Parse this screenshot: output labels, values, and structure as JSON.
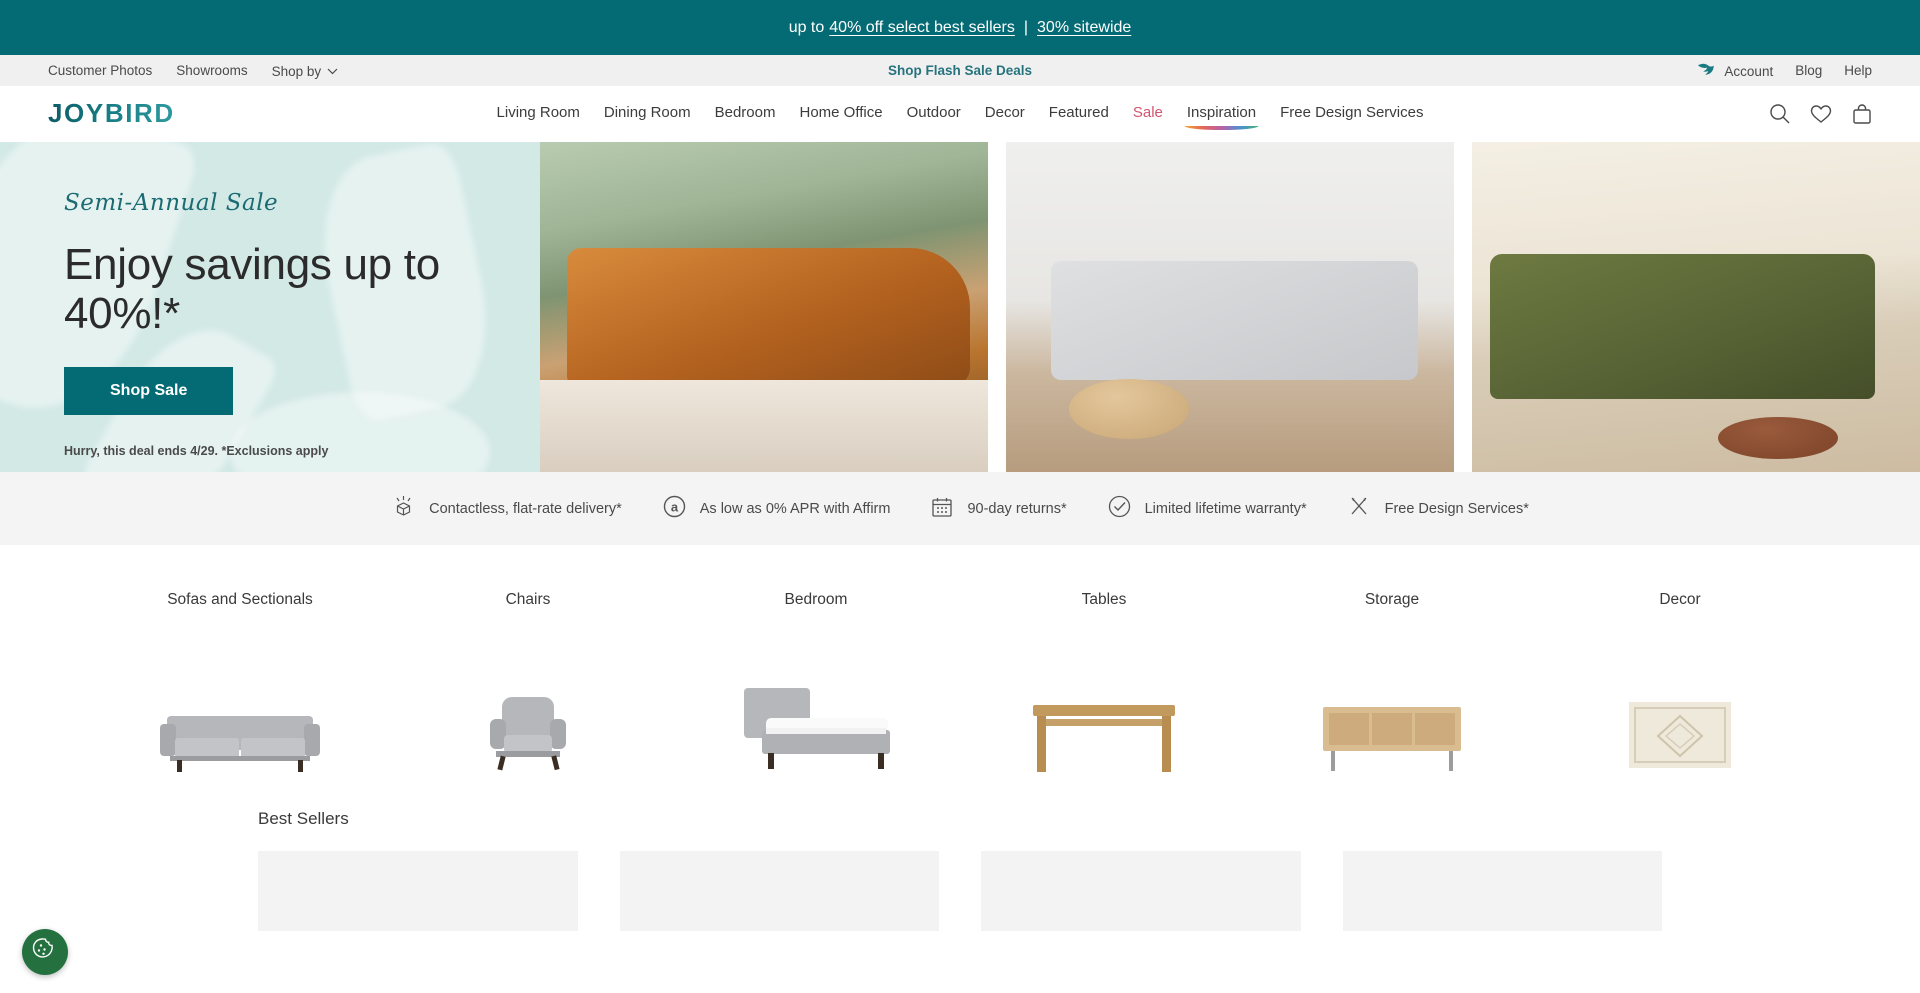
{
  "promo_bar": {
    "lead": "up to",
    "link1": "40% off select best sellers",
    "separator": "|",
    "link2": "30% sitewide"
  },
  "utility_bar": {
    "left_items": [
      {
        "label": "Customer Photos",
        "name": "customer-photos"
      },
      {
        "label": "Showrooms",
        "name": "showrooms"
      },
      {
        "label": "Shop by",
        "name": "shop-by",
        "has_chevron": true
      }
    ],
    "center_link": "Shop Flash Sale Deals",
    "right_items": [
      {
        "label": "Account",
        "name": "account"
      },
      {
        "label": "Blog",
        "name": "blog"
      },
      {
        "label": "Help",
        "name": "help"
      }
    ]
  },
  "header": {
    "logo": "JOYBIRD",
    "nav": [
      {
        "label": "Living Room",
        "style": "default"
      },
      {
        "label": "Dining Room",
        "style": "default"
      },
      {
        "label": "Bedroom",
        "style": "default"
      },
      {
        "label": "Home Office",
        "style": "default"
      },
      {
        "label": "Outdoor",
        "style": "default"
      },
      {
        "label": "Decor",
        "style": "default"
      },
      {
        "label": "Featured",
        "style": "default"
      },
      {
        "label": "Sale",
        "style": "sale"
      },
      {
        "label": "Inspiration",
        "style": "rainbow"
      },
      {
        "label": "Free Design Services",
        "style": "default"
      }
    ],
    "icons": [
      "search-icon",
      "wishlist-heart-icon",
      "shopping-bag-icon"
    ]
  },
  "hero": {
    "eyebrow": "Semi-Annual Sale",
    "title": "Enjoy savings up to 40%!*",
    "cta_label": "Shop Sale",
    "fine_print": "Hurry, this deal ends 4/29. *Exclusions apply",
    "images": [
      {
        "name": "hero-photo-caramel-leather-sectional"
      },
      {
        "name": "hero-photo-gray-sofa-loft"
      },
      {
        "name": "hero-photo-olive-green-sectional"
      }
    ]
  },
  "value_props": [
    {
      "icon": "package-delivery-icon",
      "label": "Contactless, flat-rate delivery*"
    },
    {
      "icon": "affirm-icon",
      "label": "As low as 0% APR with Affirm"
    },
    {
      "icon": "calendar-icon",
      "label": "90-day returns*"
    },
    {
      "icon": "check-circle-icon",
      "label": "Limited lifetime warranty*"
    },
    {
      "icon": "design-tools-icon",
      "label": "Free Design Services*"
    }
  ],
  "categories": [
    {
      "label": "Sofas and Sectionals",
      "art": "sofa"
    },
    {
      "label": "Chairs",
      "art": "chair"
    },
    {
      "label": "Bedroom",
      "art": "bed"
    },
    {
      "label": "Tables",
      "art": "table"
    },
    {
      "label": "Storage",
      "art": "storage"
    },
    {
      "label": "Decor",
      "art": "rug"
    }
  ],
  "best_sellers": {
    "title": "Best Sellers",
    "cards": [
      "",
      "",
      "",
      ""
    ]
  },
  "cookie_button": {
    "icon": "cookie-icon"
  },
  "colors": {
    "promo_teal": "#046a74",
    "hero_mint": "#d3e9e6",
    "sale_pink": "#d1566f",
    "link_teal": "#27737d",
    "cookie_green": "#24713f"
  }
}
